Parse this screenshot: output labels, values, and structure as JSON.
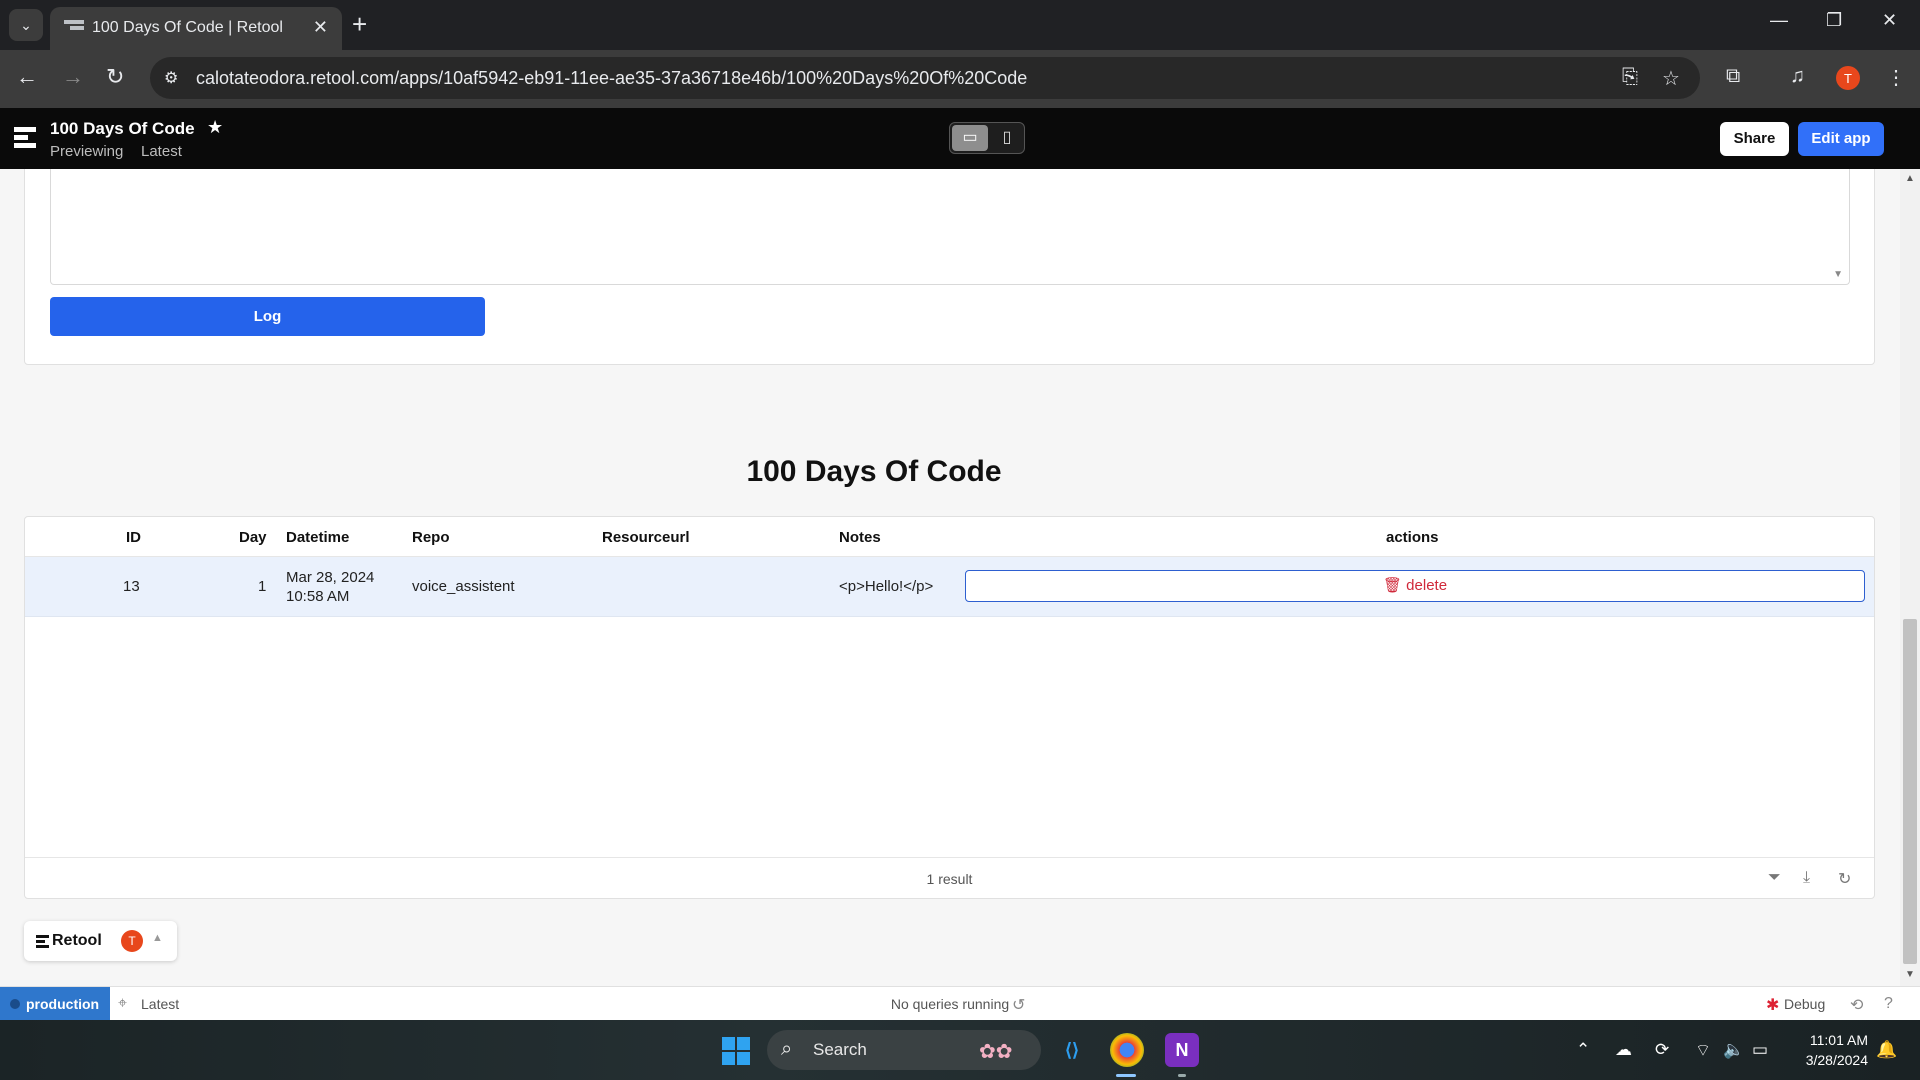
{
  "browser": {
    "tab_title": "100 Days Of Code | Retool",
    "new_tab": "+",
    "url": "calotateodora.retool.com/apps/10af5942-eb91-11ee-ae35-37a36718e46b/100%20Days%20Of%20Code",
    "profile_initial": "T"
  },
  "app_header": {
    "title": "100 Days Of Code",
    "mode": "Previewing",
    "version": "Latest",
    "share_label": "Share",
    "edit_label": "Edit app"
  },
  "form": {
    "log_button": "Log"
  },
  "page": {
    "heading": "100 Days Of Code"
  },
  "table": {
    "columns": [
      "ID",
      "Day",
      "Datetime",
      "Repo",
      "Resourceurl",
      "Notes",
      "actions"
    ],
    "rows": [
      {
        "id": "13",
        "day": "1",
        "datetime_date": "Mar 28, 2024",
        "datetime_time": "10:58 AM",
        "repo": "voice_assistent",
        "resourceurl": "",
        "notes": "<p>Hello!</p>",
        "action": "delete"
      }
    ],
    "result_count": "1 result"
  },
  "retool_pill": {
    "name": "Retool",
    "avatar": "T"
  },
  "status_bar": {
    "environment": "production",
    "version": "Latest",
    "queries": "No queries running",
    "debug": "Debug"
  },
  "taskbar": {
    "search_label": "Search",
    "time": "11:01 AM",
    "date": "3/28/2024"
  },
  "colors": {
    "primary": "#2563eb",
    "edit_button": "#3170f9",
    "delete_text": "#d0293a",
    "production": "#2f77cc",
    "avatar": "#e8471c"
  }
}
